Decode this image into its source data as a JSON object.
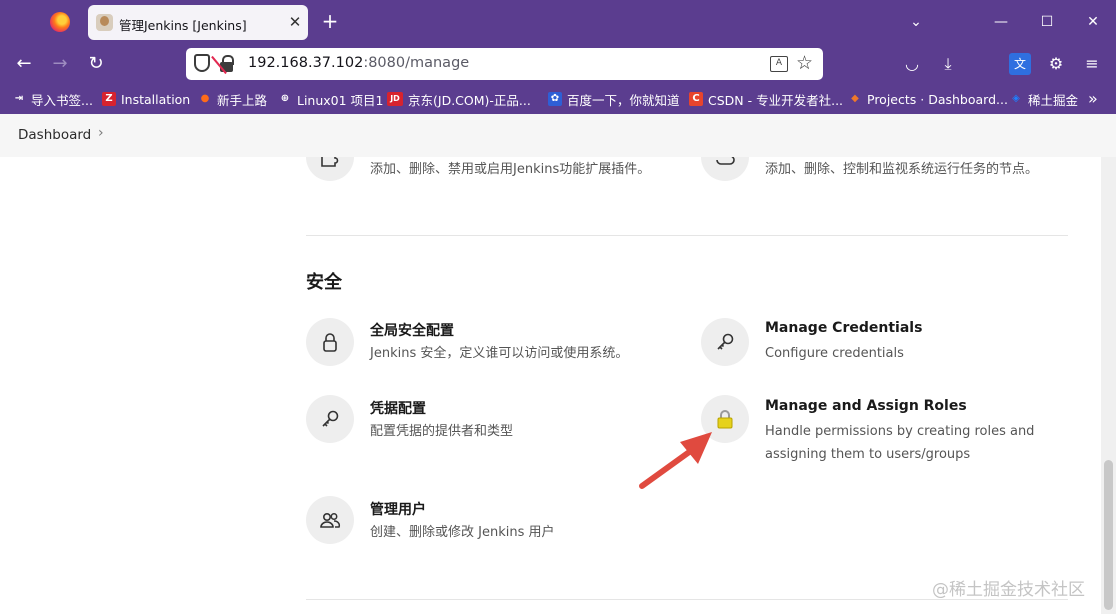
{
  "browser": {
    "tab": {
      "title": "管理Jenkins [Jenkins]",
      "close": "✕"
    },
    "new_tab": "+",
    "window_controls": {
      "minimize": "—",
      "maximize": "☐",
      "close": "✕"
    },
    "nav": {
      "back": "←",
      "forward": "→",
      "reload": "↻"
    },
    "url": {
      "host": "192.168.37.102",
      "path": ":8080/manage"
    },
    "translate_label": "A",
    "star": "☆",
    "toolbar_icons": {
      "pocket": "◡",
      "download": "⤓",
      "translate": "文",
      "extensions": "⚙",
      "menu": "≡"
    },
    "bookmarks": [
      {
        "label": "导入书签...",
        "icon": "⇥",
        "color": "#5b3d8f"
      },
      {
        "label": "Installation",
        "icon": "Z",
        "color": "#d7232e"
      },
      {
        "label": "新手上路",
        "icon": "●",
        "color": "#ff6b1a"
      },
      {
        "label": "Linux01 项目1",
        "icon": "⊕",
        "color": "#5b3d8f"
      },
      {
        "label": "京东(JD.COM)-正品...",
        "icon": "JD",
        "color": "#d7232e"
      },
      {
        "label": "百度一下，你就知道",
        "icon": "✿",
        "color": "#2e5fd6"
      },
      {
        "label": "CSDN - 专业开发者社...",
        "icon": "C",
        "color": "#e8442d"
      },
      {
        "label": "Projects · Dashboard...",
        "icon": "◆",
        "color": "#f0782a"
      },
      {
        "label": "稀土掘金",
        "icon": "◈",
        "color": "#1e80ff"
      }
    ],
    "bookmarks_more": "»"
  },
  "breadcrumb": {
    "item": "Dashboard",
    "separator": "›"
  },
  "top_items": [
    {
      "desc": "添加、删除、禁用或启用Jenkins功能扩展插件。"
    },
    {
      "desc": "添加、删除、控制和监视系统运行任务的节点。"
    }
  ],
  "security": {
    "title": "安全",
    "items": [
      {
        "title": "全局安全配置",
        "desc": "Jenkins 安全，定义谁可以访问或使用系统。",
        "icon": "lock-icon"
      },
      {
        "title": "Manage Credentials",
        "desc": "Configure credentials",
        "icon": "key-icon"
      },
      {
        "title": "凭据配置",
        "desc": "配置凭据的提供者和类型",
        "icon": "key-icon"
      },
      {
        "title": "Manage and Assign Roles",
        "desc": "Handle permissions by creating roles and assigning them to users/groups",
        "icon": "padlock-icon"
      },
      {
        "title": "管理用户",
        "desc": "创建、删除或修改 Jenkins 用户",
        "icon": "users-icon"
      }
    ]
  },
  "watermark": "@稀土掘金技术社区",
  "colors": {
    "browser_chrome": "#5b3d8f",
    "arrow": "#e04a3f",
    "padlock": "#e6d21c"
  }
}
